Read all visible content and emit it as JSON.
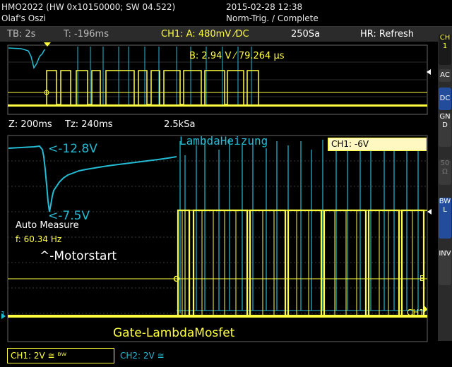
{
  "device": {
    "model_line": "HMO2022 (HW 0x10150000; SW 04.522)",
    "name": "Olaf's Oszi",
    "datetime": "2015-02-28 12:38",
    "trigger_status": "Norm-Trig. / Complete"
  },
  "status": {
    "timebase": "TB: 2s",
    "trigger_time": "T: -196ms",
    "channel_setting": "CH1: A: 480mV ⁄DC",
    "sample_rate": "250Sa",
    "refresh_mode": "HR: Refresh"
  },
  "overview": {
    "cursor_b_label": "B: 2.94 V ⁄ 79.264 µs"
  },
  "zoom": {
    "zoom_factor": "Z: 200ms",
    "zoom_time": "Tz: 240ms",
    "zoom_rate": "2.5kSa",
    "trigger_level": "CH1: -6V"
  },
  "annotations": {
    "lambda_heating": "LambdaHeizung",
    "level_high": "<-12.8V",
    "level_low": "<-7.5V",
    "motor_start": "^-Motorstart",
    "gate_mosfet": "Gate-LambdaMosfet"
  },
  "measure": {
    "title": "Auto Measure",
    "frequency": "f: 60.34 Hz"
  },
  "sidebar": {
    "ch_label": "CH1",
    "ac": "AC",
    "dc": "DC",
    "gnd": "GND",
    "fifty": "50Ω",
    "bwl": "BWL",
    "inv": "INV"
  },
  "markers": {
    "ch1_end": "CH1",
    "b_marker": "B",
    "ground_marker": "1"
  },
  "channels": {
    "ch1": "CH1: 2V ≅ ᴮᵂ",
    "ch2": "CH2: 2V ≅"
  },
  "colors": {
    "ch1": "#ffff40",
    "ch2": "#23bcd4",
    "grid": "#555555",
    "statusbar": "#2b2b2b"
  }
}
